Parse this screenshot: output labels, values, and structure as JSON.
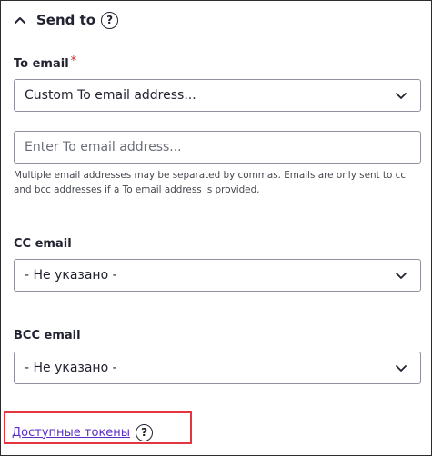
{
  "section": {
    "title": "Send to",
    "help_glyph": "?"
  },
  "to_email": {
    "label": "To email",
    "required_mark": "*",
    "selected": "Custom To email address...",
    "input_placeholder": "Enter To email address...",
    "input_value": "",
    "description": "Multiple email addresses may be separated by commas. Emails are only sent to cc and bcc addresses if a To email address is provided."
  },
  "cc_email": {
    "label": "CC email",
    "selected": "- Не указано -"
  },
  "bcc_email": {
    "label": "BCC email",
    "selected": "- Не указано -"
  },
  "tokens": {
    "link_label": "Доступные токены",
    "help_glyph": "?"
  },
  "icons": {
    "collapse": "chevron-up-icon",
    "dropdown": "chevron-down-icon",
    "help": "question-circle-icon"
  },
  "colors": {
    "text": "#222330",
    "required": "#dc2323",
    "link": "#5a2fc2",
    "highlight": "#e3363f",
    "input_border": "#8e929c"
  }
}
